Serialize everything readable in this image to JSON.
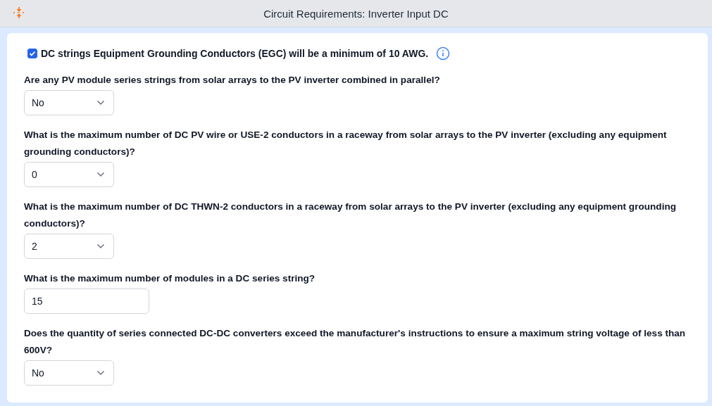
{
  "window": {
    "title": "Circuit Requirements: Inverter Input DC"
  },
  "egc_check": {
    "label": "DC strings Equipment Grounding Conductors (EGC) will be a minimum of 10 AWG.",
    "checked": true
  },
  "questions": [
    {
      "kind": "select",
      "label": "Are any PV module series strings from solar arrays to the PV inverter combined in parallel?",
      "value": "No"
    },
    {
      "kind": "select",
      "label": "What is the maximum number of DC PV wire or USE-2 conductors in a raceway from solar arrays to the PV inverter (excluding any equipment grounding conductors)?",
      "value": "0"
    },
    {
      "kind": "select",
      "label": "What is the maximum number of DC THWN-2 conductors in a raceway from solar arrays to the PV inverter (excluding any equipment grounding conductors)?",
      "value": "2"
    },
    {
      "kind": "text",
      "label": "What is the maximum number of modules in a DC series string?",
      "value": "15"
    },
    {
      "kind": "select",
      "label": "Does the quantity of series connected DC-DC converters exceed the manufacturer's instructions to ensure a maximum string voltage of less than 600V?",
      "value": "No"
    }
  ]
}
